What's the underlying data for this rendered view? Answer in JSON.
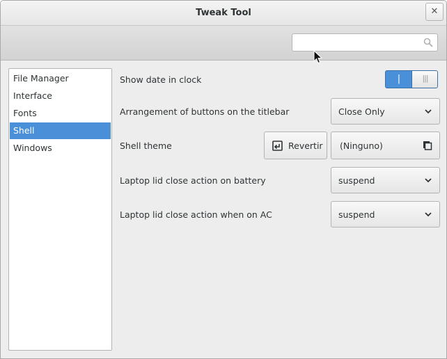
{
  "window": {
    "title": "Tweak Tool",
    "close_glyph": "✕"
  },
  "search": {
    "value": "",
    "placeholder": "",
    "icon": "search-icon"
  },
  "sidebar": {
    "items": [
      {
        "label": "File Manager",
        "selected": false
      },
      {
        "label": "Interface",
        "selected": false
      },
      {
        "label": "Fonts",
        "selected": false
      },
      {
        "label": "Shell",
        "selected": true
      },
      {
        "label": "Windows",
        "selected": false
      }
    ]
  },
  "settings": {
    "show_date": {
      "label": "Show date in clock",
      "on_glyph": "|",
      "knob_glyph": "|||",
      "enabled": true
    },
    "titlebar_buttons": {
      "label": "Arrangement of buttons on the titlebar",
      "value": "Close Only"
    },
    "shell_theme": {
      "label": "Shell theme",
      "revert_label": "Revertir",
      "value": "(Ninguno)"
    },
    "lid_battery": {
      "label": "Laptop lid close action on battery",
      "value": "suspend"
    },
    "lid_ac": {
      "label": "Laptop lid close action when on AC",
      "value": "suspend"
    }
  },
  "colors": {
    "selection": "#4a90d9",
    "background": "#ededed"
  }
}
